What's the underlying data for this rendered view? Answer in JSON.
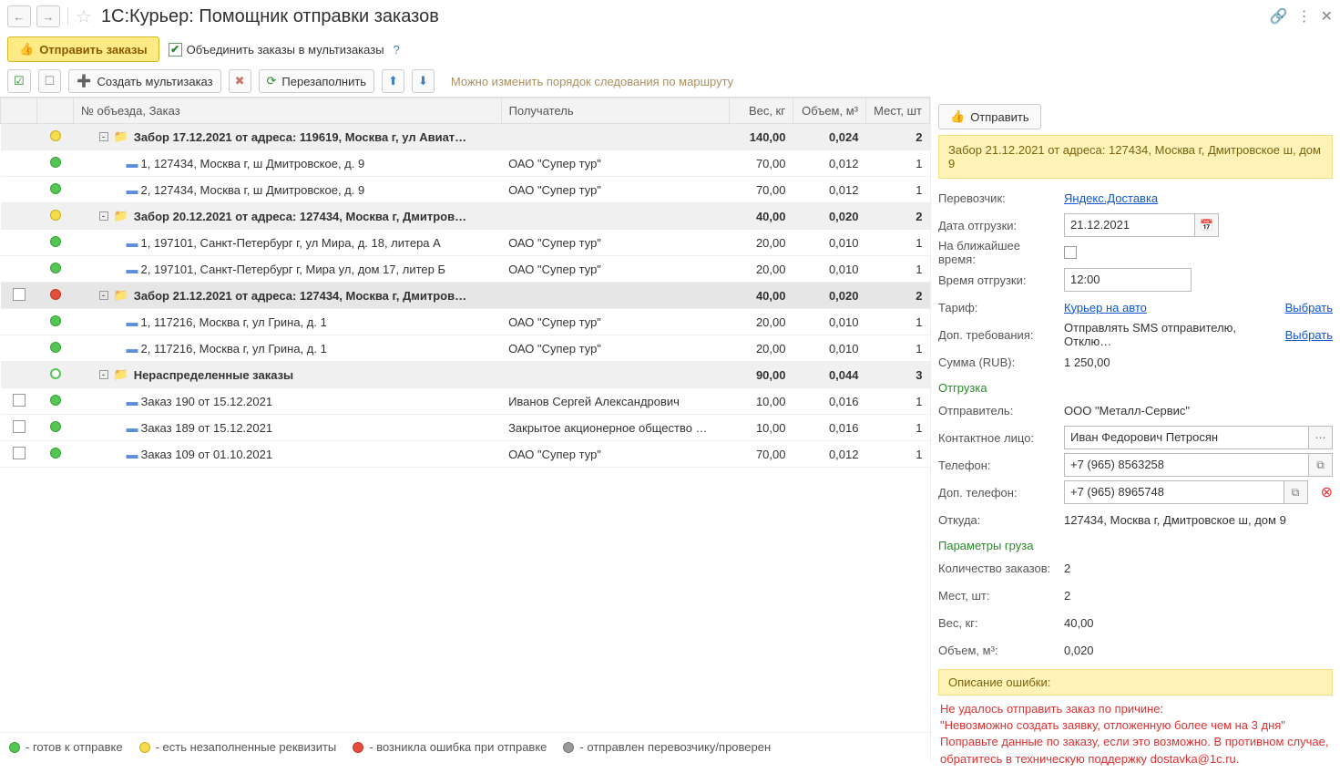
{
  "title": "1С:Курьер: Помощник отправки заказов",
  "toolbar": {
    "send_orders": "Отправить заказы",
    "combine_label": "Объединить заказы в мультизаказы",
    "create_multi": "Создать мультизаказ",
    "refill": "Перезаполнить",
    "route_hint": "Можно изменить порядок следования по маршруту"
  },
  "table": {
    "headers": {
      "route": "№ объезда, Заказ",
      "recipient": "Получатель",
      "weight": "Вес, кг",
      "volume": "Объем, м³",
      "places": "Мест, шт"
    },
    "rows": [
      {
        "type": "group",
        "status": "yellow",
        "toggle": "-",
        "name": "Забор 17.12.2021 от адреса: 119619, Москва г, ул Авиат…",
        "weight": "140,00",
        "volume": "0,024",
        "places": "2"
      },
      {
        "type": "item",
        "status": "green",
        "indent": 2,
        "name": "1, 127434, Москва г, ш Дмитровское, д. 9",
        "recipient": "ОАО \"Супер тур\"",
        "weight": "70,00",
        "volume": "0,012",
        "places": "1"
      },
      {
        "type": "item",
        "status": "green",
        "indent": 2,
        "name": "2, 127434, Москва г, ш Дмитровское, д. 9",
        "recipient": "ОАО \"Супер тур\"",
        "weight": "70,00",
        "volume": "0,012",
        "places": "1"
      },
      {
        "type": "group",
        "status": "yellow",
        "toggle": "-",
        "name": "Забор 20.12.2021 от адреса: 127434, Москва г, Дмитров…",
        "weight": "40,00",
        "volume": "0,020",
        "places": "2"
      },
      {
        "type": "item",
        "status": "green",
        "indent": 2,
        "name": "1, 197101, Санкт-Петербург г, ул Мира, д. 18, литера А",
        "recipient": "ОАО \"Супер тур\"",
        "weight": "20,00",
        "volume": "0,010",
        "places": "1"
      },
      {
        "type": "item",
        "status": "green",
        "indent": 2,
        "name": "2, 197101, Санкт-Петербург г, Мира ул, дом 17, литер Б",
        "recipient": "ОАО \"Супер тур\"",
        "weight": "20,00",
        "volume": "0,010",
        "places": "1"
      },
      {
        "type": "group",
        "status": "red",
        "toggle": "-",
        "selected": true,
        "checkbox": true,
        "name": "Забор 21.12.2021 от адреса: 127434, Москва г, Дмитров…",
        "weight": "40,00",
        "volume": "0,020",
        "places": "2"
      },
      {
        "type": "item",
        "status": "green",
        "indent": 2,
        "name": "1, 117216, Москва г, ул Грина, д. 1",
        "recipient": "ОАО \"Супер тур\"",
        "weight": "20,00",
        "volume": "0,010",
        "places": "1"
      },
      {
        "type": "item",
        "status": "green",
        "indent": 2,
        "name": "2, 117216, Москва г, ул Грина, д. 1",
        "recipient": "ОАО \"Супер тур\"",
        "weight": "20,00",
        "volume": "0,010",
        "places": "1"
      },
      {
        "type": "group",
        "status": "green-o",
        "toggle": "-",
        "name": "Нераспределенные заказы",
        "weight": "90,00",
        "volume": "0,044",
        "places": "3"
      },
      {
        "type": "item",
        "status": "green",
        "indent": 2,
        "checkbox": true,
        "name": "Заказ 190 от 15.12.2021",
        "recipient": "Иванов Сергей Александрович",
        "weight": "10,00",
        "volume": "0,016",
        "places": "1"
      },
      {
        "type": "item",
        "status": "green",
        "indent": 2,
        "checkbox": true,
        "name": "Заказ 189 от 15.12.2021",
        "recipient": "Закрытое акционерное общество …",
        "weight": "10,00",
        "volume": "0,016",
        "places": "1"
      },
      {
        "type": "item",
        "status": "green",
        "indent": 2,
        "checkbox": true,
        "name": "Заказ 109 от 01.10.2021",
        "recipient": "ОАО \"Супер тур\"",
        "weight": "70,00",
        "volume": "0,012",
        "places": "1"
      }
    ]
  },
  "details": {
    "send_btn": "Отправить",
    "banner": "Забор 21.12.2021 от адреса: 127434, Москва г, Дмитровское ш, дом 9",
    "labels": {
      "carrier": "Перевозчик:",
      "ship_date": "Дата отгрузки:",
      "nearest": "На ближайшее время:",
      "ship_time": "Время отгрузки:",
      "tariff": "Тариф:",
      "extra_req": "Доп. требования:",
      "sum": "Сумма (RUB):",
      "shipment": "Отгрузка",
      "sender": "Отправитель:",
      "contact": "Контактное лицо:",
      "phone": "Телефон:",
      "extra_phone": "Доп. телефон:",
      "from": "Откуда:",
      "cargo_params": "Параметры груза",
      "order_count": "Количество заказов:",
      "places": "Мест, шт:",
      "weight": "Вес, кг:",
      "volume": "Объем, м³:",
      "error_desc": "Описание ошибки:"
    },
    "values": {
      "carrier": "Яндекс.Доставка",
      "ship_date": "21.12.2021",
      "ship_time": "12:00",
      "tariff": "Курьер на авто",
      "choose": "Выбрать",
      "extra_req": "Отправлять SMS отправителю, Отклю…",
      "sum": "1 250,00",
      "sender": "ООО \"Металл-Сервис\"",
      "contact": "Иван Федорович Петросян",
      "phone": "+7 (965) 8563258",
      "extra_phone": "+7 (965) 8965748",
      "from": "127434, Москва г, Дмитровское ш, дом 9",
      "order_count": "2",
      "places": "2",
      "weight": "40,00",
      "volume": "0,020"
    },
    "error_text": "Не удалось отправить заказ по причине:\n\"Невозможно создать заявку, отложенную более чем на 3 дня\"\nПоправьте данные по заказу, если это возможно. В противном случае, обратитесь в техническую поддержку dostavka@1c.ru."
  },
  "legend": {
    "ready": "- готов к отправке",
    "incomplete": "- есть незаполненные реквизиты",
    "error": "- возникла ошибка при отправке",
    "sent": "- отправлен перевозчику/проверен"
  }
}
